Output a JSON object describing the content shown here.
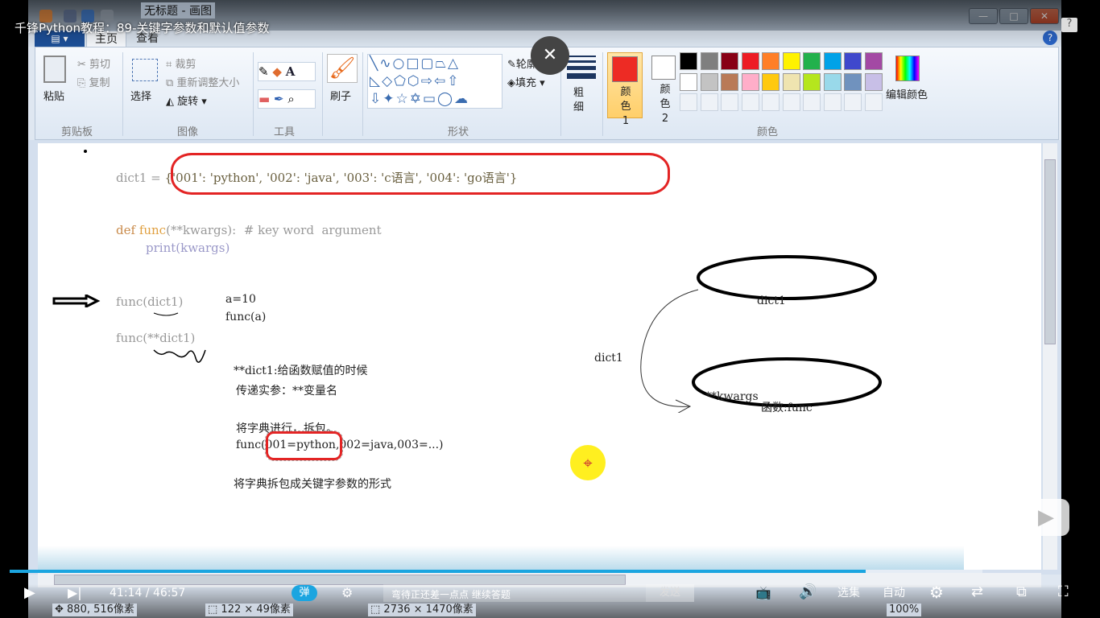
{
  "video": {
    "title": "千锋Python教程：89-关键字参数和默认值参数",
    "current_time": "41:14",
    "total_time": "46:57",
    "separator": "/",
    "progress": 0.88,
    "danmaku_btn": "弹",
    "danmaku_placeholder": "弯待正还差一点点 继续答题",
    "send_label": "发送",
    "episodes_label": "选集",
    "auto_label": "自动"
  },
  "paint": {
    "window_title": "无标题 - 画图",
    "tabs": [
      "主页",
      "查看"
    ],
    "clipboard": {
      "paste": "粘贴",
      "cut": "剪切",
      "copy": "复制",
      "group": "剪贴板"
    },
    "image": {
      "select": "选择",
      "crop": "裁剪",
      "resize": "重新调整大小",
      "rotate": "旋转",
      "group": "图像"
    },
    "tools": {
      "group": "工具"
    },
    "brush": "刷子",
    "shapes": {
      "outline": "轮廓",
      "fill": "填充",
      "group": "形状"
    },
    "size": "粗细",
    "color1": "颜色 1",
    "color2": "颜色 2",
    "edit_colors": "编辑颜色",
    "colors_group": "颜色",
    "palette": [
      "#000000",
      "#7f7f7f",
      "#880015",
      "#ed1c24",
      "#ff7f27",
      "#fff200",
      "#22b14c",
      "#00a2e8",
      "#3f48cc",
      "#a349a4",
      "#ffffff",
      "#c3c3c3",
      "#b97a57",
      "#ffaec9",
      "#ffc90e",
      "#efe4b0",
      "#b5e61d",
      "#99d9ea",
      "#7092be",
      "#c8bfe7"
    ],
    "color1_value": "#ed2b24",
    "status": {
      "cursor": "880, 516像素",
      "selection": "122 × 49像素",
      "size": "2736 × 1470像素",
      "zoom": "100%"
    }
  },
  "canvas": {
    "dict_prefix": "dict1 = ",
    "dict_value": "{'001': 'python', '002': 'java', '003': 'c语言', '004': 'go语言'}",
    "def_kw": "def ",
    "def_name": "func",
    "def_args": "(**kwargs):  # key word  argument",
    "print_line": "print(kwargs)",
    "call1": "func(dict1)",
    "call2": "func(**dict1)",
    "a_line": "a=10",
    "func_a": "func(a)",
    "note1": "**dict1:给函数赋值的时候",
    "note2": "传递实参：**变量名",
    "note3": "将字典进行，拆包。",
    "note4_a": "func(",
    "note4_b": "001=python",
    "note4_c": ",002=java,003=...)",
    "note5": "将字典拆包成关键字参数的形式",
    "ellipse1_label": "dict1",
    "arrow_label": "dict1",
    "ellipse2_label1": "**kwargs",
    "ellipse2_label2": "函数:func"
  }
}
